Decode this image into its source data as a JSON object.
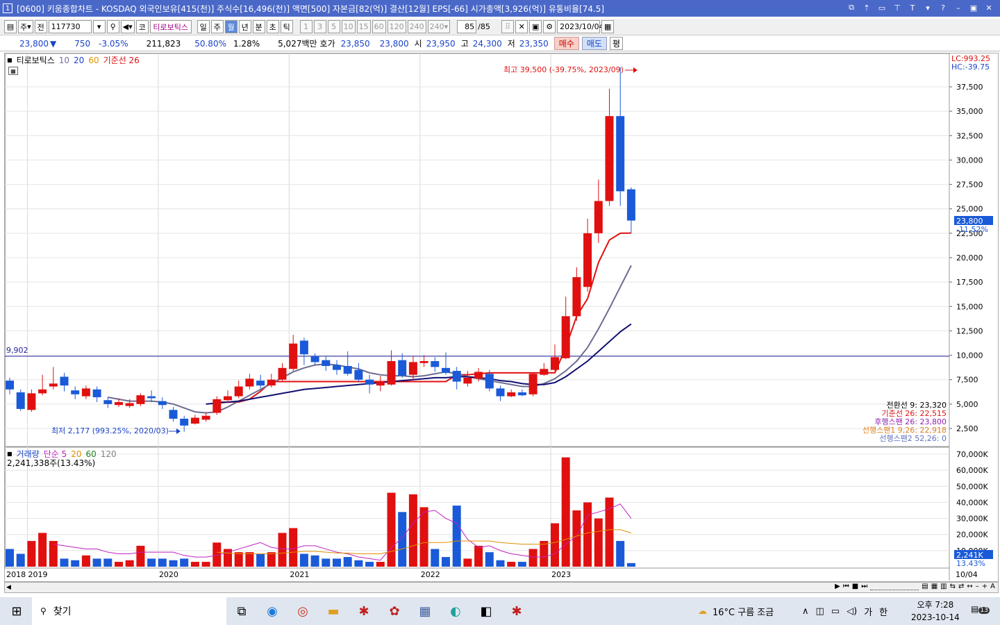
{
  "title": {
    "num": "1",
    "text": "[0600] 키움종합차트 - KOSDAQ 외국인보유[415(천)] 주식수[16,496(천)] 액면[500] 자본금[82(억)] 결산[12월] EPS[-66] 시가총액[3,926(억)] 유통비율[74.5]"
  },
  "toolbar": {
    "period": "주",
    "type": "전",
    "code": "117730",
    "kospi": "코",
    "stock_name": "티로보틱스",
    "periods": [
      "일",
      "주",
      "월",
      "년",
      "분",
      "초",
      "틱"
    ],
    "selected_period": "월",
    "intervals": [
      "1",
      "3",
      "5",
      "10",
      "15",
      "60",
      "120",
      "240"
    ],
    "interval_value": "240",
    "count": "85",
    "count_total": "/85",
    "date": "2023/10/04"
  },
  "quote": {
    "price": "23,800",
    "arrow": "▼",
    "change": "750",
    "change_pct": "-3.05%",
    "volume": "211,823",
    "vol_ratio": "50.80%",
    "turnover": "1.28%",
    "amount": "5,027백만",
    "hoga_label": "호가",
    "ask": "23,850",
    "bid": "23,800",
    "open_label": "시",
    "open": "23,950",
    "high_label": "고",
    "high": "24,300",
    "low_label": "저",
    "low": "23,350",
    "buy": "매수",
    "sell": "매도",
    "eval": "평"
  },
  "price_panel": {
    "name": "티로보틱스",
    "ma1": "10",
    "ma2": "20",
    "ma3": "60",
    "kijun": "기준선 26",
    "lc": "LC:993.25",
    "hc": "HC:-39.75",
    "max_label": "최고 39,500 (-39.75%, 2023/09)",
    "min_label": "최저 2,177 (993.25%, 2020/03)",
    "hline_label": "9,902",
    "current_box": "23,800",
    "current_pct": "-11.52%",
    "ichimoku": [
      "전환선 9: 23,320",
      "기준선 26: 22,515",
      "후행스팬 26: 23,800",
      "선행스팬1 9,26: 22,918",
      "선행스팬2 52,26: 0"
    ],
    "ichimoku_colors": [
      "#000000",
      "#e01010",
      "#9020b0",
      "#e08020",
      "#6070c0"
    ],
    "y_ticks": [
      "37,500",
      "35,000",
      "32,500",
      "30,000",
      "27,500",
      "25,000",
      "22,500",
      "20,000",
      "17,500",
      "15,000",
      "12,500",
      "10,000",
      "7,500",
      "5,000",
      "2,500"
    ]
  },
  "volume_panel": {
    "name": "거래량",
    "ma_label": "단순 5",
    "ma2": "20",
    "ma3": "60",
    "ma4": "120",
    "value": "2,241,338주(13.43%)",
    "y_ticks": [
      "70,000K",
      "60,000K",
      "50,000K",
      "40,000K",
      "30,000K",
      "20,000K",
      "10,000K"
    ],
    "current_box": "2,241K",
    "current_pct": "13.43%"
  },
  "x_labels": [
    "2018",
    "2019",
    "2020",
    "2021",
    "2022",
    "2023"
  ],
  "x_right": "10/04",
  "taskbar": {
    "search": "찾기",
    "weather": "16°C  구름 조금",
    "lang": "가",
    "ime": "한",
    "time": "오후 7:28",
    "date": "2023-10-14",
    "notif": "13"
  },
  "chart_data": {
    "type": "candlestick",
    "period": "monthly",
    "candles": [
      {
        "o": 7400,
        "c": 6500,
        "h": 7700,
        "l": 6000
      },
      {
        "o": 6200,
        "c": 4500,
        "h": 6500,
        "l": 4300
      },
      {
        "o": 4400,
        "c": 6100,
        "h": 6500,
        "l": 4200
      },
      {
        "o": 6100,
        "c": 6500,
        "h": 8000,
        "l": 5900
      },
      {
        "o": 6800,
        "c": 7100,
        "h": 8800,
        "l": 6500
      },
      {
        "o": 7800,
        "c": 6900,
        "h": 8200,
        "l": 6300
      },
      {
        "o": 6400,
        "c": 6000,
        "h": 6800,
        "l": 5500
      },
      {
        "o": 5800,
        "c": 6600,
        "h": 6900,
        "l": 5500
      },
      {
        "o": 6500,
        "c": 5700,
        "h": 6800,
        "l": 5200
      },
      {
        "o": 5400,
        "c": 5000,
        "h": 5700,
        "l": 4600
      },
      {
        "o": 4900,
        "c": 5200,
        "h": 5600,
        "l": 4700
      },
      {
        "o": 4800,
        "c": 5100,
        "h": 5500,
        "l": 4600
      },
      {
        "o": 5000,
        "c": 5900,
        "h": 6100,
        "l": 4800
      },
      {
        "o": 5800,
        "c": 5600,
        "h": 6400,
        "l": 5200
      },
      {
        "o": 5300,
        "c": 4900,
        "h": 5700,
        "l": 4500
      },
      {
        "o": 4400,
        "c": 3500,
        "h": 4700,
        "l": 3200
      },
      {
        "o": 3500,
        "c": 2800,
        "h": 3800,
        "l": 2177
      },
      {
        "o": 3000,
        "c": 3600,
        "h": 3900,
        "l": 2900
      },
      {
        "o": 3400,
        "c": 3800,
        "h": 4100,
        "l": 3200
      },
      {
        "o": 4100,
        "c": 5500,
        "h": 5800,
        "l": 3900
      },
      {
        "o": 5400,
        "c": 5800,
        "h": 6400,
        "l": 5100
      },
      {
        "o": 5800,
        "c": 6800,
        "h": 7400,
        "l": 5600
      },
      {
        "o": 6800,
        "c": 7600,
        "h": 8100,
        "l": 6500
      },
      {
        "o": 7400,
        "c": 6900,
        "h": 8000,
        "l": 6600
      },
      {
        "o": 6900,
        "c": 7500,
        "h": 8100,
        "l": 6700
      },
      {
        "o": 7500,
        "c": 8700,
        "h": 9200,
        "l": 7300
      },
      {
        "o": 8600,
        "c": 11200,
        "h": 12100,
        "l": 8400
      },
      {
        "o": 11500,
        "c": 10100,
        "h": 11800,
        "l": 9000
      },
      {
        "o": 9900,
        "c": 9300,
        "h": 10200,
        "l": 9000
      },
      {
        "o": 9500,
        "c": 8900,
        "h": 9900,
        "l": 8400
      },
      {
        "o": 9000,
        "c": 8500,
        "h": 9500,
        "l": 8000
      },
      {
        "o": 8900,
        "c": 8100,
        "h": 10400,
        "l": 7900
      },
      {
        "o": 8500,
        "c": 7500,
        "h": 9200,
        "l": 7300
      },
      {
        "o": 7500,
        "c": 7000,
        "h": 8000,
        "l": 6100
      },
      {
        "o": 6900,
        "c": 7300,
        "h": 7900,
        "l": 6300
      },
      {
        "o": 7000,
        "c": 9400,
        "h": 10500,
        "l": 6900
      },
      {
        "o": 9500,
        "c": 7900,
        "h": 10200,
        "l": 7700
      },
      {
        "o": 8000,
        "c": 9300,
        "h": 9900,
        "l": 7500
      },
      {
        "o": 9200,
        "c": 9400,
        "h": 10000,
        "l": 8800
      },
      {
        "o": 9400,
        "c": 8800,
        "h": 9800,
        "l": 8300
      },
      {
        "o": 8700,
        "c": 8200,
        "h": 10300,
        "l": 8000
      },
      {
        "o": 8400,
        "c": 7300,
        "h": 8800,
        "l": 6500
      },
      {
        "o": 7100,
        "c": 7700,
        "h": 8400,
        "l": 6800
      },
      {
        "o": 7600,
        "c": 8300,
        "h": 8700,
        "l": 7300
      },
      {
        "o": 8100,
        "c": 6600,
        "h": 8500,
        "l": 6300
      },
      {
        "o": 6600,
        "c": 5800,
        "h": 6900,
        "l": 5300
      },
      {
        "o": 5800,
        "c": 6200,
        "h": 6500,
        "l": 5700
      },
      {
        "o": 6200,
        "c": 5900,
        "h": 6500,
        "l": 5800
      },
      {
        "o": 6000,
        "c": 8100,
        "h": 8200,
        "l": 5800
      },
      {
        "o": 8000,
        "c": 8600,
        "h": 9200,
        "l": 7900
      },
      {
        "o": 8500,
        "c": 9800,
        "h": 11100,
        "l": 8400
      },
      {
        "o": 9700,
        "c": 14000,
        "h": 16000,
        "l": 9600
      },
      {
        "o": 14000,
        "c": 18000,
        "h": 19000,
        "l": 13500
      },
      {
        "o": 17000,
        "c": 22500,
        "h": 24000,
        "l": 16500
      },
      {
        "o": 22500,
        "c": 25800,
        "h": 28000,
        "l": 21500
      },
      {
        "o": 25800,
        "c": 34500,
        "h": 37300,
        "l": 25300
      },
      {
        "o": 34500,
        "c": 26800,
        "h": 39500,
        "l": 25300
      },
      {
        "o": 27000,
        "c": 23800,
        "h": 27200,
        "l": 22500
      }
    ],
    "volume_k": [
      11000,
      8000,
      16000,
      21000,
      16000,
      5000,
      4000,
      7000,
      5000,
      5000,
      3000,
      4000,
      13000,
      5000,
      5000,
      4000,
      5000,
      3000,
      3000,
      15000,
      11000,
      9000,
      9000,
      8000,
      9000,
      21000,
      24000,
      8000,
      7000,
      5000,
      5000,
      6000,
      4000,
      3000,
      3000,
      46000,
      34000,
      45000,
      37000,
      11000,
      6000,
      38000,
      5000,
      13000,
      9000,
      4000,
      3000,
      3000,
      11000,
      16000,
      27000,
      68000,
      35000,
      40000,
      30000,
      43000,
      16000,
      2241
    ],
    "kijun": [
      null,
      null,
      null,
      null,
      null,
      null,
      null,
      null,
      null,
      null,
      null,
      null,
      null,
      null,
      null,
      null,
      null,
      null,
      null,
      5200,
      5200,
      5200,
      5500,
      6300,
      7300,
      7300,
      7300,
      7300,
      7300,
      7300,
      7300,
      7300,
      7300,
      7300,
      7300,
      7300,
      7300,
      7300,
      7300,
      7300,
      7300,
      8000,
      8000,
      8100,
      8200,
      8200,
      8200,
      8200,
      8200,
      8200,
      8200,
      10800,
      14000,
      15800,
      19500,
      21800,
      22500,
      22515
    ],
    "line_gray": [
      null,
      null,
      null,
      null,
      null,
      null,
      null,
      null,
      null,
      5700,
      5500,
      5300,
      5300,
      5300,
      5200,
      5000,
      4600,
      4200,
      4100,
      4200,
      4700,
      5300,
      5900,
      6500,
      7100,
      7700,
      8300,
      8700,
      9000,
      9100,
      9000,
      8800,
      8600,
      8200,
      8000,
      7900,
      7900,
      7800,
      7900,
      8100,
      8300,
      8100,
      7800,
      7600,
      7400,
      7200,
      7000,
      6800,
      6800,
      7100,
      7600,
      8400,
      9400,
      10800,
      12700,
      14800,
      17000,
      19200
    ],
    "line_navy": [
      null,
      null,
      null,
      null,
      null,
      null,
      null,
      null,
      null,
      null,
      null,
      null,
      null,
      null,
      null,
      null,
      null,
      null,
      5000,
      5100,
      5200,
      5300,
      5500,
      5700,
      5900,
      6100,
      6300,
      6500,
      6600,
      6700,
      6800,
      6900,
      7000,
      7100,
      7200,
      7300,
      7400,
      7500,
      7600,
      7700,
      7700,
      7800,
      7800,
      7700,
      7600,
      7400,
      7300,
      7100,
      7000,
      7000,
      7200,
      7800,
      8600,
      9400,
      10400,
      11400,
      12400,
      13200
    ],
    "vol_ma5": [
      null,
      null,
      null,
      null,
      14000,
      13000,
      12000,
      11000,
      11000,
      9000,
      8000,
      8000,
      9000,
      9000,
      9000,
      9000,
      7000,
      6000,
      6000,
      7000,
      9000,
      11000,
      13000,
      15000,
      12000,
      11000,
      11000,
      13000,
      13000,
      11000,
      9000,
      8000,
      6000,
      5000,
      4000,
      12000,
      18000,
      27000,
      34000,
      35000,
      30000,
      27000,
      17000,
      12000,
      13000,
      10000,
      8000,
      7000,
      6000,
      6000,
      8000,
      14000,
      19000,
      32000,
      34000,
      36000,
      39000,
      30000
    ],
    "vol_ma20": [
      null,
      null,
      null,
      null,
      null,
      null,
      null,
      null,
      null,
      null,
      null,
      null,
      null,
      null,
      null,
      null,
      null,
      null,
      null,
      9000,
      8500,
      8000,
      8000,
      8000,
      8000,
      8500,
      9000,
      9500,
      9500,
      9000,
      8500,
      8500,
      8000,
      8000,
      8000,
      9500,
      11000,
      13000,
      15000,
      15000,
      15000,
      16000,
      16000,
      16000,
      16000,
      15000,
      14500,
      14000,
      14000,
      14000,
      15000,
      17000,
      19000,
      21000,
      22000,
      23000,
      23000,
      21000
    ],
    "ylim": [
      0,
      42000
    ],
    "hline": 9902,
    "xlabel_months": {
      "2018": 0,
      "2019": 2,
      "2020": 14,
      "2021": 26,
      "2022": 38,
      "2023": 50
    }
  }
}
